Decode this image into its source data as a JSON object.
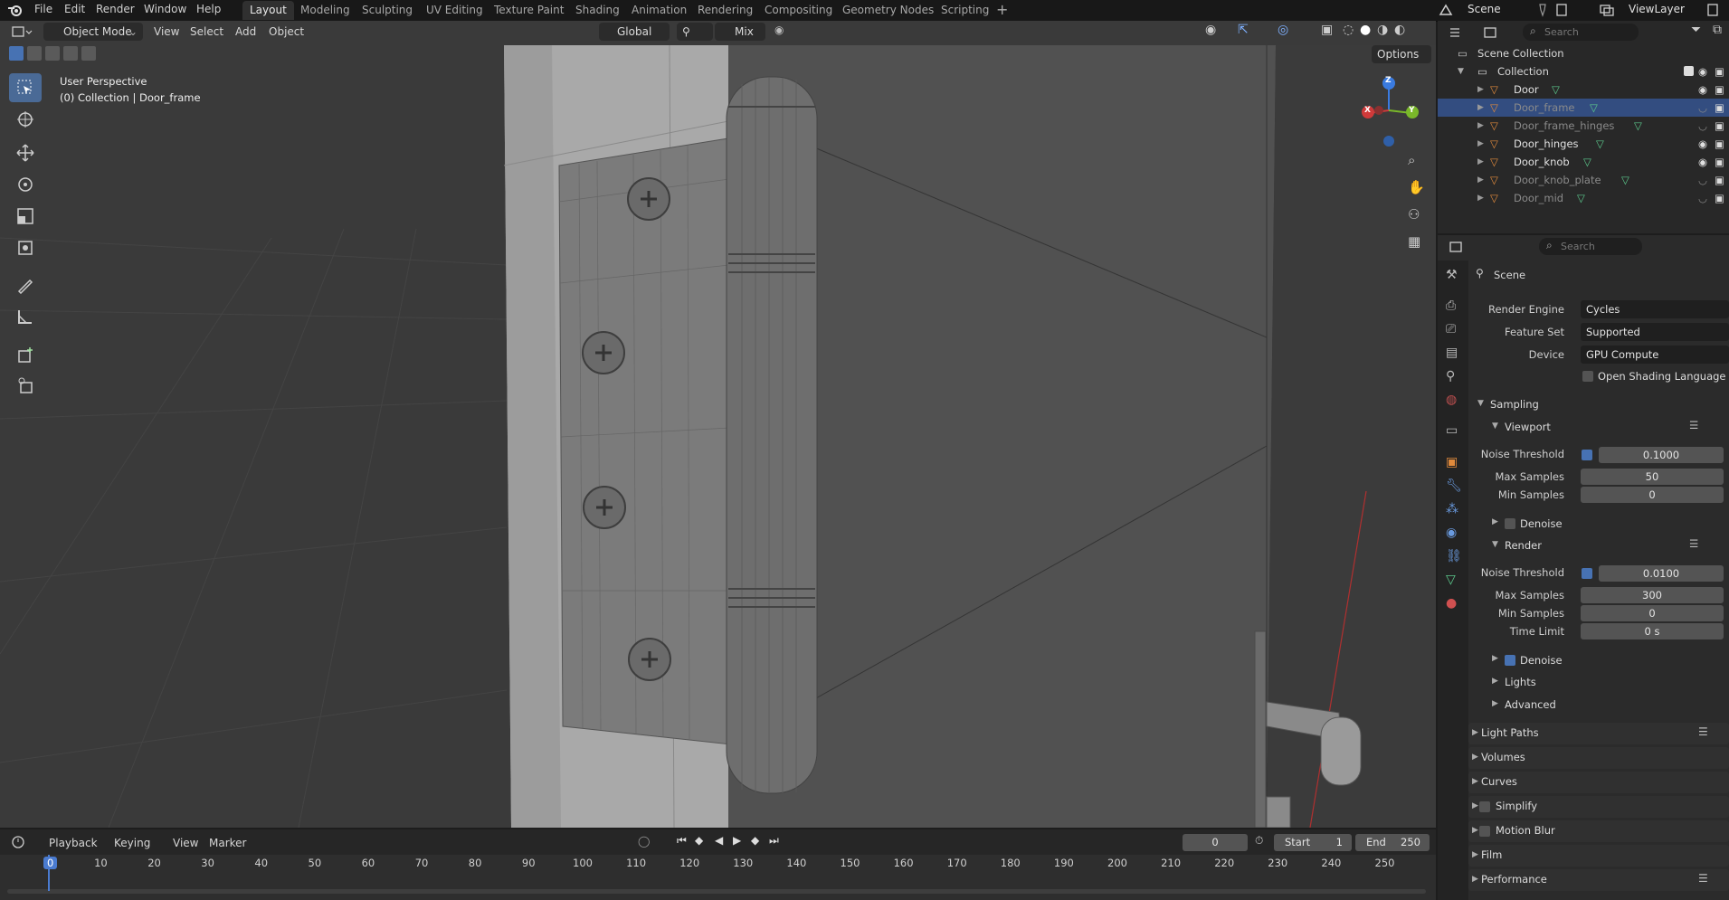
{
  "topbar": {
    "menu": [
      "File",
      "Edit",
      "Render",
      "Window",
      "Help"
    ],
    "workspaces": [
      "Layout",
      "Modeling",
      "Sculpting",
      "UV Editing",
      "Texture Paint",
      "Shading",
      "Animation",
      "Rendering",
      "Compositing",
      "Geometry Nodes",
      "Scripting"
    ],
    "active_workspace": "Layout",
    "scene": "Scene",
    "view_layer": "ViewLayer"
  },
  "viewport": {
    "mode": "Object Mode",
    "menus": [
      "View",
      "Select",
      "Add",
      "Object"
    ],
    "orientation": "Global",
    "snap_mode": "Mix",
    "options_label": "Options",
    "overlay_line1": "User Perspective",
    "overlay_line2": "(0) Collection | Door_frame",
    "gizmo_axes": [
      "Z",
      "X",
      "Y"
    ]
  },
  "outliner": {
    "search_placeholder": "Search",
    "root": "Scene Collection",
    "collection": "Collection",
    "items": [
      {
        "name": "Door",
        "visible": true,
        "selected": false
      },
      {
        "name": "Door_frame",
        "visible": false,
        "selected": true
      },
      {
        "name": "Door_frame_hinges",
        "visible": false,
        "selected": false
      },
      {
        "name": "Door_hinges",
        "visible": true,
        "selected": false
      },
      {
        "name": "Door_knob",
        "visible": true,
        "selected": false
      },
      {
        "name": "Door_knob_plate",
        "visible": false,
        "selected": false
      },
      {
        "name": "Door_mid",
        "visible": false,
        "selected": false
      }
    ]
  },
  "properties": {
    "search_placeholder": "Search",
    "context": "Scene",
    "render_engine_label": "Render Engine",
    "render_engine": "Cycles",
    "feature_set_label": "Feature Set",
    "feature_set": "Supported",
    "device_label": "Device",
    "device": "GPU Compute",
    "osl_label": "Open Shading Language",
    "sampling": "Sampling",
    "viewport_label": "Viewport",
    "noise_threshold_label": "Noise Threshold",
    "max_samples_label": "Max Samples",
    "min_samples_label": "Min Samples",
    "time_limit_label": "Time Limit",
    "vp_noise_threshold": "0.1000",
    "vp_max_samples": "50",
    "vp_min_samples": "0",
    "denoise_label": "Denoise",
    "render_label": "Render",
    "r_noise_threshold": "0.0100",
    "r_max_samples": "300",
    "r_min_samples": "0",
    "r_time_limit": "0 s",
    "lights_label": "Lights",
    "advanced_label": "Advanced",
    "panels": [
      "Light Paths",
      "Volumes",
      "Curves",
      "Simplify",
      "Motion Blur",
      "Film",
      "Performance"
    ]
  },
  "timeline": {
    "menus": [
      "Playback",
      "Keying",
      "View",
      "Marker"
    ],
    "current_frame": "0",
    "start_label": "Start",
    "start": "1",
    "end_label": "End",
    "end": "250",
    "ticks": [
      "0",
      "10",
      "20",
      "30",
      "40",
      "50",
      "60",
      "70",
      "80",
      "90",
      "100",
      "110",
      "120",
      "130",
      "140",
      "150",
      "160",
      "170",
      "180",
      "190",
      "200",
      "210",
      "220",
      "230",
      "240",
      "250"
    ]
  },
  "colors": {
    "accent": "#4772b3",
    "selected_row": "#334d80",
    "playhead": "#4a7bd0",
    "mesh_icon": "#e08a3c",
    "data_icon": "#5cc98c"
  }
}
